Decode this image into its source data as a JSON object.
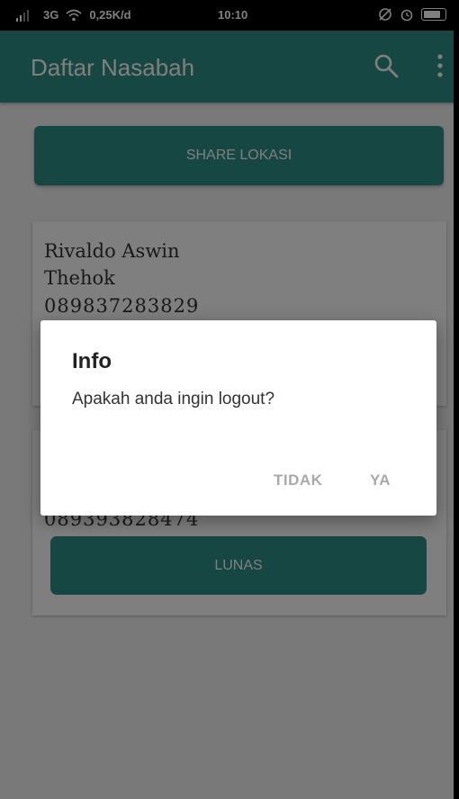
{
  "status_bar": {
    "network": "3G",
    "speed": "0,25K/d",
    "time": "10:10"
  },
  "appbar": {
    "title": "Daftar Nasabah",
    "search_icon": "search-icon",
    "more_icon": "more-vert-icon"
  },
  "share_button": "SHARE LOKASI",
  "cards": [
    {
      "name_line1": "Rivaldo Aswin",
      "name_line2": "Thehok",
      "phone": "089837283829"
    },
    {
      "phone": "089393828474",
      "button": "LUNAS"
    }
  ],
  "dialog": {
    "title": "Info",
    "message": "Apakah anda ingin logout?",
    "cancel_label": "TIDAK",
    "confirm_label": "YA"
  },
  "colors": {
    "primary": "#2f8f86",
    "dialog_button_text": "#a9a9a9"
  }
}
